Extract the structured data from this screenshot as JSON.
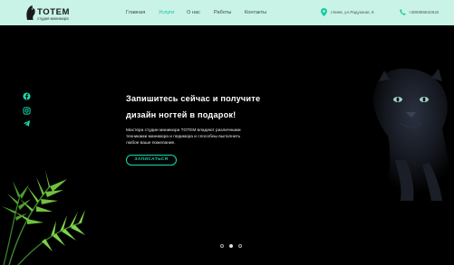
{
  "brand": {
    "name": "TOTEM",
    "tagline": "студия маникюра"
  },
  "nav": [
    {
      "label": "Главная",
      "active": false
    },
    {
      "label": "Услуги",
      "active": true
    },
    {
      "label": "О нас",
      "active": false
    },
    {
      "label": "Работы",
      "active": false
    },
    {
      "label": "Контакты",
      "active": false
    }
  ],
  "contacts": {
    "address": "г.Киев, ул.Радужная, 9",
    "phone": "+380986842542"
  },
  "social": [
    "facebook-icon",
    "instagram-icon",
    "telegram-icon"
  ],
  "hero": {
    "title_line1": "Запишитесь сейчас и получите",
    "title_line2": "дизайн ногтей в подарок!",
    "description": "Мастера студии маникюра TOTEM владеют различными техниками маникюра и педикюра и способны выполнить любое ваше пожелание.",
    "cta_label": "ЗАПИСАТЬСЯ"
  },
  "slider": {
    "count": 3,
    "active_index": 1
  },
  "colors": {
    "header_bg": "#c8f3e6",
    "accent": "#17d9ad",
    "hero_bg": "#000000"
  }
}
